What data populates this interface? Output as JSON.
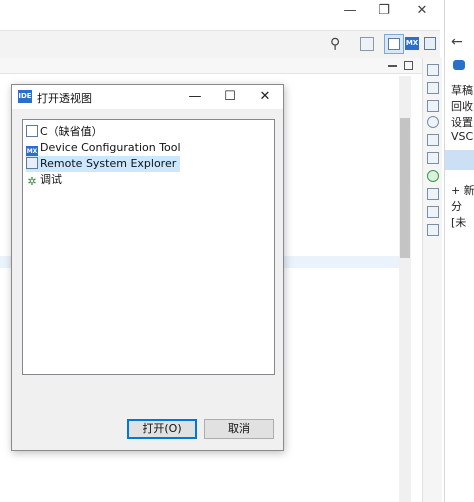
{
  "window": {
    "restore_glyph": "❐",
    "close_glyph": "✕"
  },
  "toolbar": {
    "search_glyph": "⚲"
  },
  "right_panel": {
    "items": [
      "草稿",
      "回收",
      "设置",
      "VSC",
      "+ 新",
      "分",
      "[未"
    ]
  },
  "dialog": {
    "badge": "IDE",
    "title": "打开透视图",
    "minimize_glyph": "—",
    "maximize_glyph": "☐",
    "close_glyph": "✕",
    "perspectives": [
      {
        "label": "C（缺省值）",
        "icon": "c-perspective-icon"
      },
      {
        "label": "Device Configuration Tool",
        "icon": "mx-icon"
      },
      {
        "label": "Remote System Explorer",
        "icon": "remote-system-icon"
      },
      {
        "label": "调试",
        "icon": "debug-icon"
      }
    ],
    "selected_index": 2,
    "open_button": "打开(O)",
    "cancel_button": "取消"
  },
  "colors": {
    "accent": "#0078d7",
    "selection": "#cce8ff",
    "ide_badge": "#2a6fc9"
  }
}
